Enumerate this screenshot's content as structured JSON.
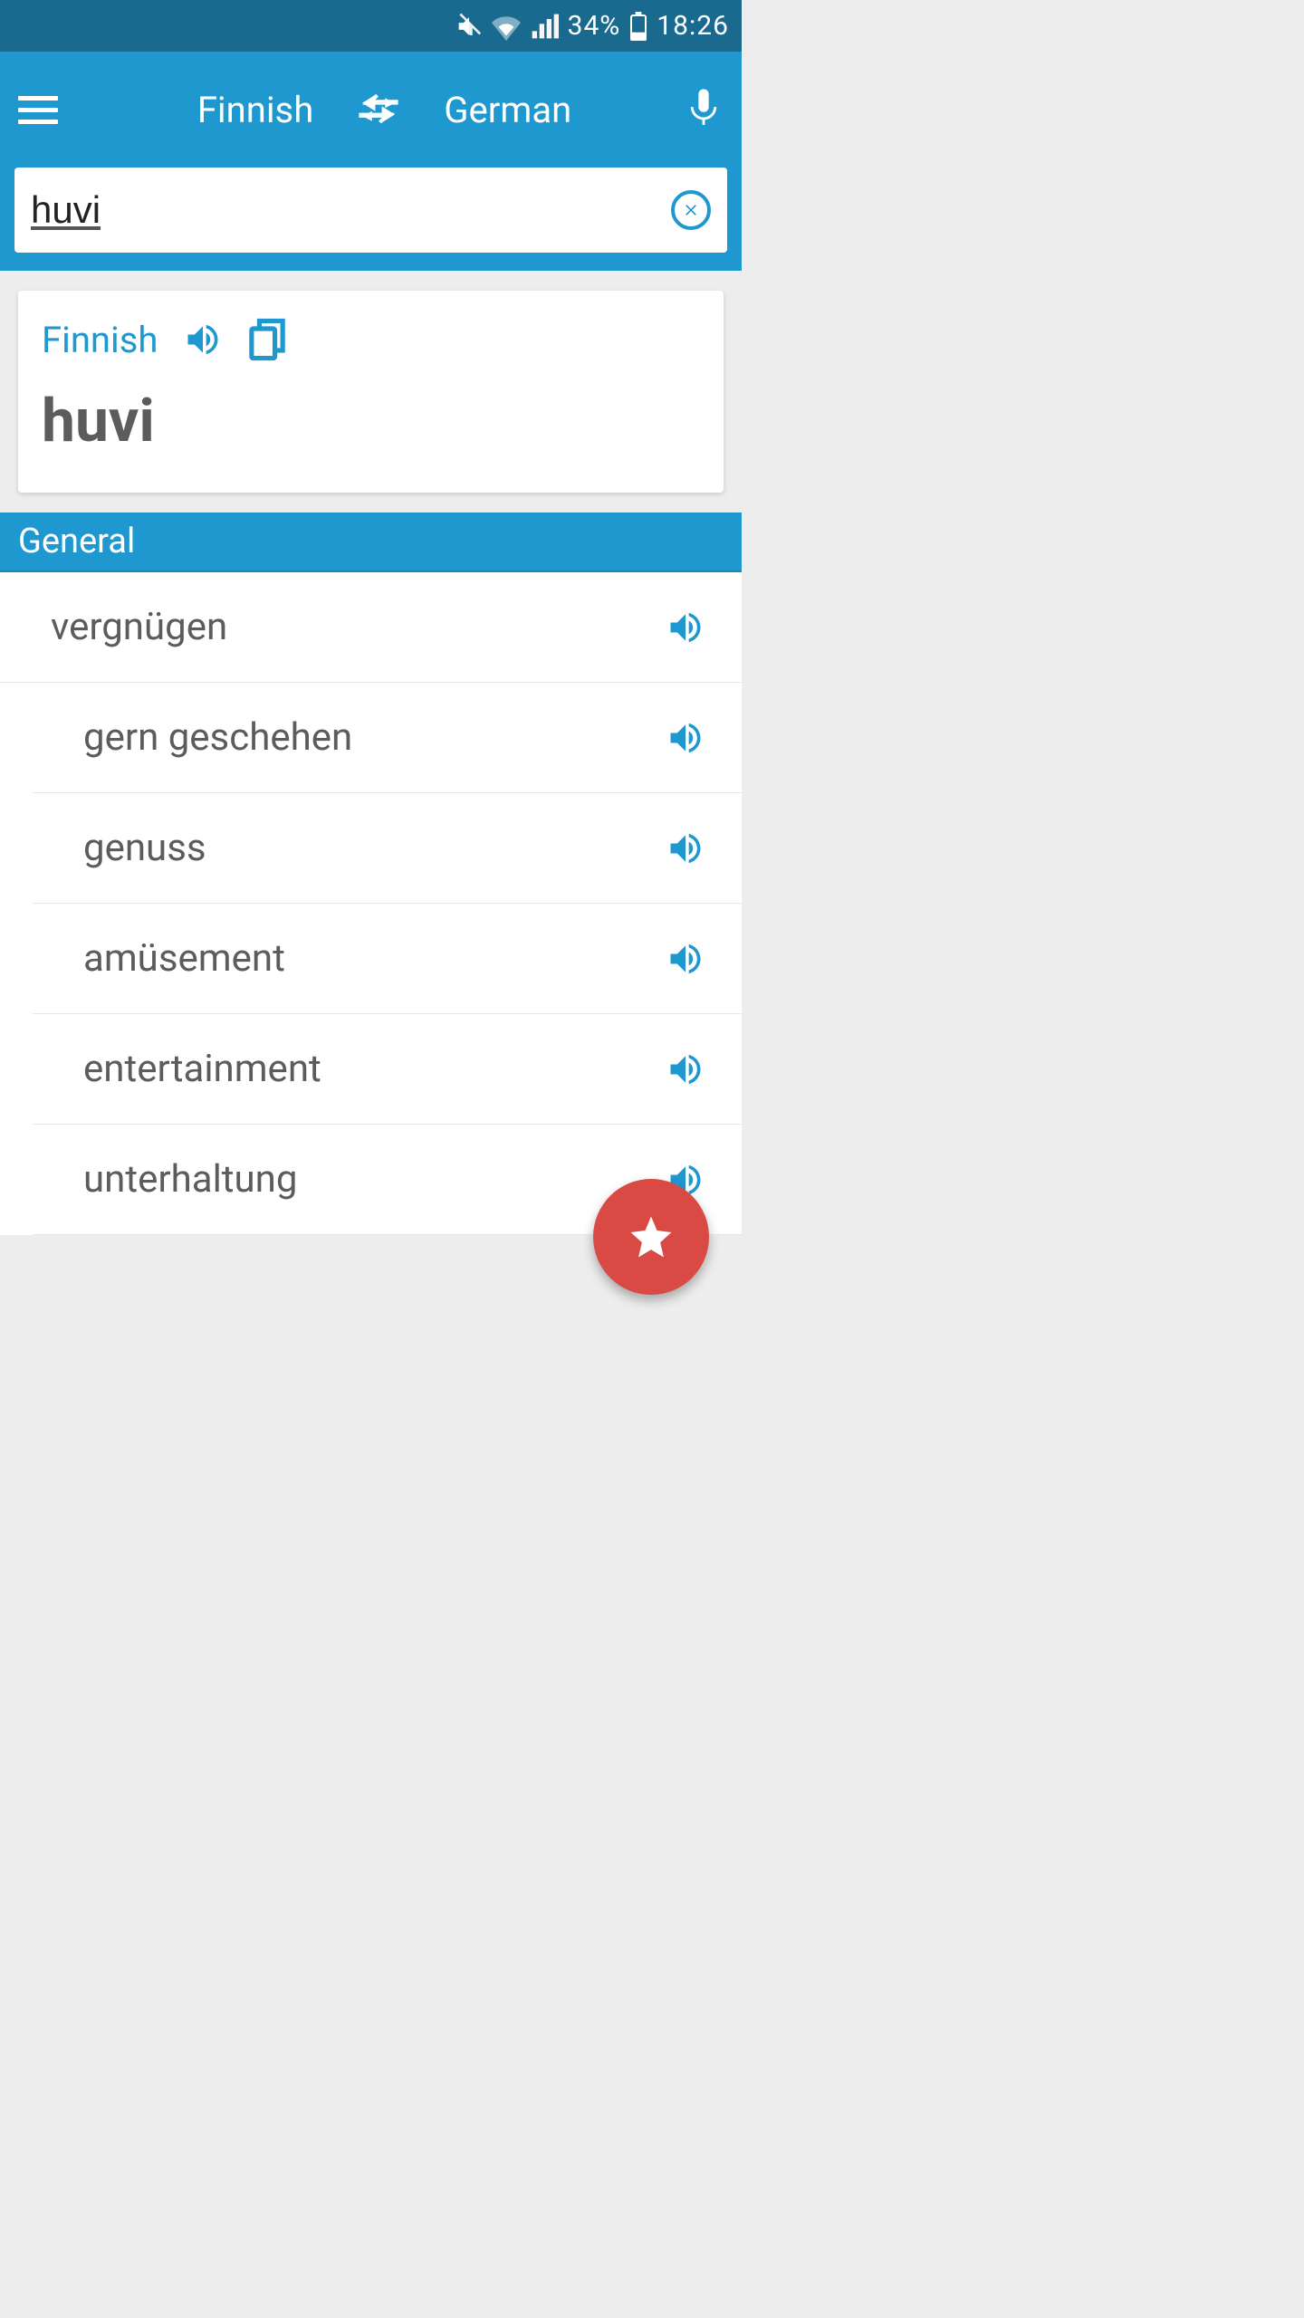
{
  "status_bar": {
    "battery": "34%",
    "time": "18:26"
  },
  "header": {
    "source_lang": "Finnish",
    "target_lang": "German"
  },
  "search": {
    "value": "huvi"
  },
  "source_card": {
    "lang_label": "Finnish",
    "word": "huvi"
  },
  "section": {
    "title": "General"
  },
  "translations": [
    {
      "text": "vergnügen"
    },
    {
      "text": "gern geschehen"
    },
    {
      "text": "genuss"
    },
    {
      "text": "amüsement"
    },
    {
      "text": "entertainment"
    },
    {
      "text": "unterhaltung"
    }
  ],
  "colors": {
    "primary": "#1e98cf",
    "status_bg": "#1a6a8f",
    "fab": "#d94a45"
  }
}
